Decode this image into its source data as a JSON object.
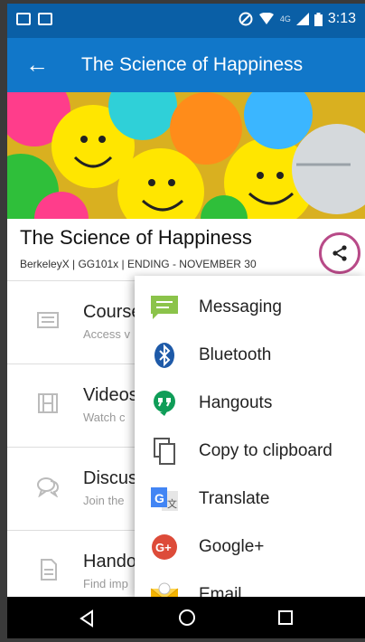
{
  "status_bar": {
    "network": "4G",
    "time": "3:13"
  },
  "app_bar": {
    "back_icon": "arrow-left-icon",
    "title": "The Science of Happiness"
  },
  "course": {
    "title": "The Science of Happiness",
    "subtitle": "BerkeleyX | GG101x | ENDING - NOVEMBER 30"
  },
  "menu": [
    {
      "label": "Course",
      "sub": "Access v",
      "icon": "courseware-icon"
    },
    {
      "label": "Videos",
      "sub": "Watch c",
      "icon": "film-icon"
    },
    {
      "label": "Discus",
      "sub": "Join the",
      "icon": "discussion-icon"
    },
    {
      "label": "Hando",
      "sub": "Find imp",
      "icon": "document-icon"
    }
  ],
  "share_menu": [
    {
      "label": "Messaging",
      "icon": "messaging-icon",
      "color": "#8bc34a"
    },
    {
      "label": "Bluetooth",
      "icon": "bluetooth-icon",
      "color": "#1e5aa8"
    },
    {
      "label": "Hangouts",
      "icon": "hangouts-icon",
      "color": "#0f9d58"
    },
    {
      "label": "Copy to clipboard",
      "icon": "clipboard-icon",
      "color": "#555555"
    },
    {
      "label": "Translate",
      "icon": "translate-icon",
      "color": "#4285f4"
    },
    {
      "label": "Google+",
      "icon": "google-plus-icon",
      "color": "#dd4b39"
    },
    {
      "label": "Email",
      "icon": "email-icon",
      "color": "#f4b400"
    }
  ],
  "colors": {
    "status_bar": "#0a5fa6",
    "app_bar": "#1177c9",
    "annotation": "#b84a88"
  }
}
